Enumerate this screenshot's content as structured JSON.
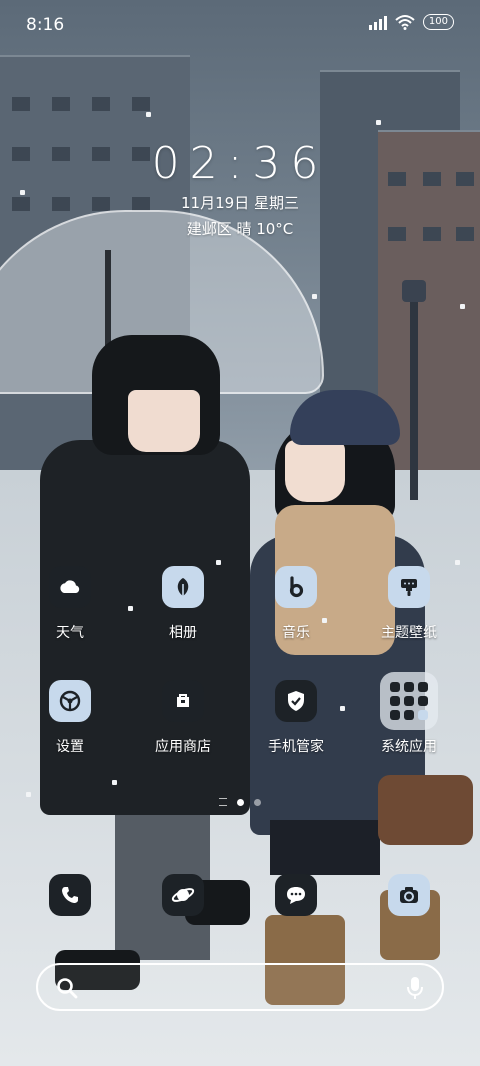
{
  "status_bar": {
    "time": "8:16",
    "battery": "100"
  },
  "lock_clock": {
    "time": "02:36",
    "date": "11月19日 星期三",
    "weather": "建邺区 晴 10°C"
  },
  "apps_row1": [
    {
      "label": "天气",
      "icon": "weather-icon"
    },
    {
      "label": "相册",
      "icon": "leaf-icon"
    },
    {
      "label": "音乐",
      "icon": "music-b-icon"
    },
    {
      "label": "主题壁纸",
      "icon": "theme-icon"
    }
  ],
  "apps_row2": [
    {
      "label": "设置",
      "icon": "settings-icon"
    },
    {
      "label": "应用商店",
      "icon": "store-icon"
    },
    {
      "label": "手机管家",
      "icon": "security-shield-icon"
    },
    {
      "label": "系统应用",
      "icon": "folder-icon"
    }
  ],
  "pager": {
    "pages": 2,
    "current": 1
  },
  "dock": [
    "phone-icon",
    "browser-planet-icon",
    "messages-icon",
    "camera-icon"
  ],
  "colors": {
    "icon_dark": "#1d2227",
    "icon_light": "#c7d9ec",
    "text": "#ffffff"
  }
}
